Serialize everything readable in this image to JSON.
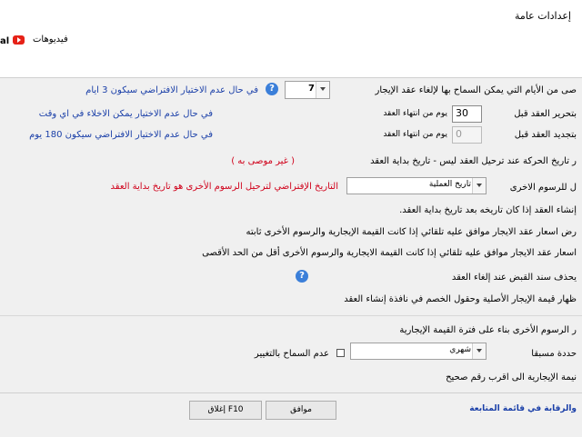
{
  "window": {
    "title": "إعدادات عامة"
  },
  "toolbar": {
    "videos_label": "فيديوهات",
    "partial_label": "al"
  },
  "settings": {
    "cancel_days": {
      "label": "صى من الأيام التي يمكن السماح بها لإلغاء عقد الإيجار",
      "value": "7",
      "note": "في حال عدم الاختيار الافتراضي سيكون 3 ايام"
    },
    "alert_before": {
      "label": "بتحرير العقد قبل",
      "value": "30",
      "unit": "يوم من انتهاء العقد",
      "note": "في حال عدم الاختيار يمكن الاخلاء في اي وقت"
    },
    "renew_before": {
      "label": "بتجديد العقد قبل",
      "value": "0",
      "unit": "يوم من انتهاء العقد",
      "note": "في حال عدم الاختيار الافتراضي سيكون 180 يوم"
    },
    "movement_date": {
      "label": "ر تاريخ الحركة عند ترحيل العقد ليس - تاريخ بداية العقد",
      "note": "( غير موصى به )"
    },
    "other_fees": {
      "label": "ل للرسوم الاخرى",
      "value": "تاريخ العملية",
      "note": "التاريخ الإفتراضي لترحيل الرسوم الأخرى هو تاريخ بداية العقد"
    },
    "line_create": "إنشاء العقد إذا كان تاريخه بعد تاريخ بداية العقد.",
    "line_approve_fixed": "رض اسعار عقد الايجار موافق عليه تلقائي  إذا كانت القيمة الإيجارية والرسوم الأخرى ثابته",
    "line_approve_less": "اسعار عقد الايجار موافق عليه تلقائي  إذا كانت القيمة الايجارية والرسوم الأخرى أقل من الحد الأقصى",
    "line_delete_receipt": "يحذف سند القبض عند إلغاء العقد",
    "line_show_original": "ظهار قيمة الإيجار الأصلية وحقول الخصم في نافذة إنشاء العقد",
    "line_other_fees_period": "ر الرسوم الأخرى بناء على فترة القيمة الإيجارية",
    "predefined": {
      "label": "حددة مسبقا",
      "value": "شهري",
      "checkbox_label": "عدم السماح بالتغيير"
    },
    "line_round": "نيمة الإيجارية الى اقرب رقم صحيح"
  },
  "footer": {
    "ok_label": "موافق",
    "close_label": "إغلاق F10",
    "monitor_link": "والرقابة في قائمة المتابعة"
  },
  "colors": {
    "note_blue": "#1a3fa8",
    "note_red": "#d0021b",
    "help_blue": "#3b7fd9",
    "youtube_red": "#e62117"
  }
}
